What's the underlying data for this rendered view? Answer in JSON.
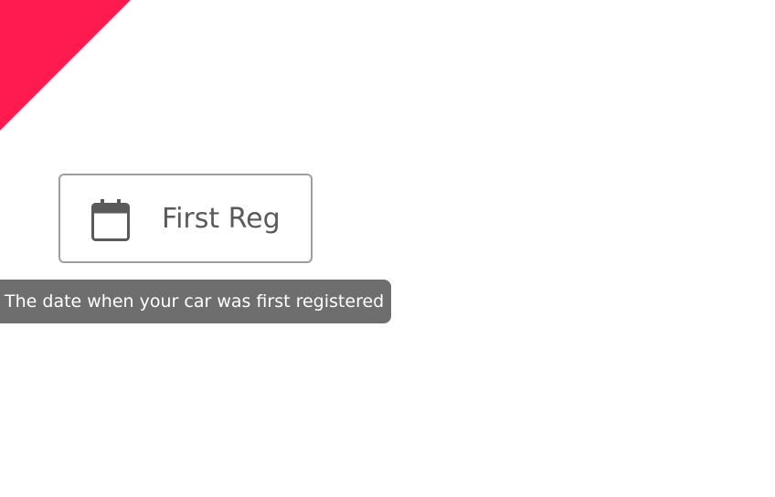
{
  "colors": {
    "accent": "#ff1a4f",
    "field_border": "#9e9e9e",
    "field_text": "#5a5a5a",
    "tooltip_bg": "#6e6e6e",
    "tooltip_text": "#ffffff"
  },
  "date_field": {
    "icon": "calendar-icon",
    "label": "First Reg"
  },
  "tooltip": {
    "text": "The date when your car was first registered"
  }
}
